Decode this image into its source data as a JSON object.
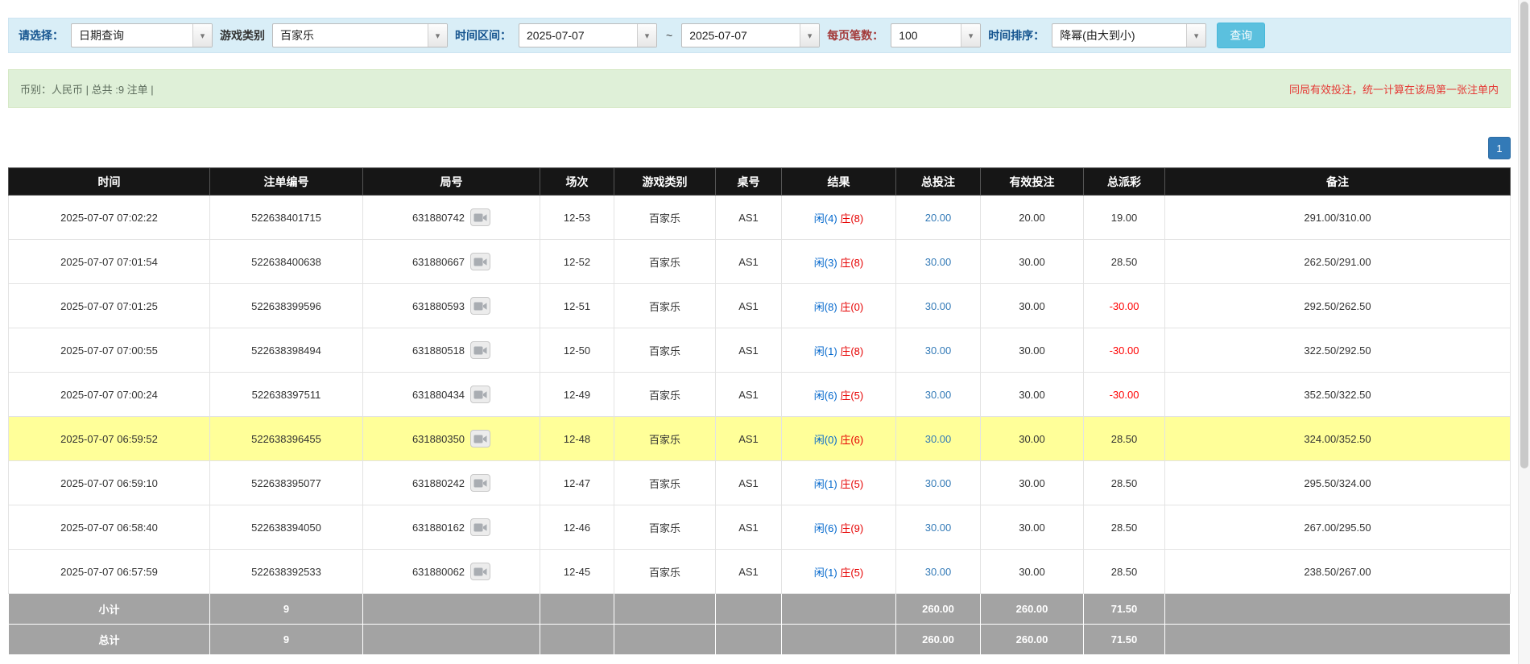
{
  "icons": {
    "chevron_down": "▾"
  },
  "filters": {
    "select_label": "请选择：",
    "select_value": "日期查询",
    "game_type_label": "游戏类别",
    "game_type_value": "百家乐",
    "time_range_label": "时间区间：",
    "date_from": "2025-07-07",
    "range_separator": "~",
    "date_to": "2025-07-07",
    "page_size_label": "每页笔数：",
    "page_size_value": "100",
    "sort_label": "时间排序：",
    "sort_value": "降幂(由大到小)",
    "search_button": "查询"
  },
  "summary": {
    "left": "币别：人民币 | 总共 :9 注单 |",
    "right": "同局有效投注，统一计算在该局第一张注单内"
  },
  "pagination": {
    "current_page": "1"
  },
  "table": {
    "headers": [
      "时间",
      "注单编号",
      "局号",
      "场次",
      "游戏类别",
      "桌号",
      "结果",
      "总投注",
      "有效投注",
      "总派彩",
      "备注"
    ],
    "rows": [
      {
        "time": "2025-07-07 07:02:22",
        "bet_id": "522638401715",
        "round_id": "631880742",
        "session": "12-53",
        "game": "百家乐",
        "table_no": "AS1",
        "result_player": "闲(4)",
        "result_banker": "庄(8)",
        "total_bet": "20.00",
        "valid_bet": "20.00",
        "payout": "19.00",
        "note": "291.00/310.00",
        "highlight": false
      },
      {
        "time": "2025-07-07 07:01:54",
        "bet_id": "522638400638",
        "round_id": "631880667",
        "session": "12-52",
        "game": "百家乐",
        "table_no": "AS1",
        "result_player": "闲(3)",
        "result_banker": "庄(8)",
        "total_bet": "30.00",
        "valid_bet": "30.00",
        "payout": "28.50",
        "note": "262.50/291.00",
        "highlight": false
      },
      {
        "time": "2025-07-07 07:01:25",
        "bet_id": "522638399596",
        "round_id": "631880593",
        "session": "12-51",
        "game": "百家乐",
        "table_no": "AS1",
        "result_player": "闲(8)",
        "result_banker": "庄(0)",
        "total_bet": "30.00",
        "valid_bet": "30.00",
        "payout": "-30.00",
        "note": "292.50/262.50",
        "highlight": false
      },
      {
        "time": "2025-07-07 07:00:55",
        "bet_id": "522638398494",
        "round_id": "631880518",
        "session": "12-50",
        "game": "百家乐",
        "table_no": "AS1",
        "result_player": "闲(1)",
        "result_banker": "庄(8)",
        "total_bet": "30.00",
        "valid_bet": "30.00",
        "payout": "-30.00",
        "note": "322.50/292.50",
        "highlight": false
      },
      {
        "time": "2025-07-07 07:00:24",
        "bet_id": "522638397511",
        "round_id": "631880434",
        "session": "12-49",
        "game": "百家乐",
        "table_no": "AS1",
        "result_player": "闲(6)",
        "result_banker": "庄(5)",
        "total_bet": "30.00",
        "valid_bet": "30.00",
        "payout": "-30.00",
        "note": "352.50/322.50",
        "highlight": false
      },
      {
        "time": "2025-07-07 06:59:52",
        "bet_id": "522638396455",
        "round_id": "631880350",
        "session": "12-48",
        "game": "百家乐",
        "table_no": "AS1",
        "result_player": "闲(0)",
        "result_banker": "庄(6)",
        "total_bet": "30.00",
        "valid_bet": "30.00",
        "payout": "28.50",
        "note": "324.00/352.50",
        "highlight": true
      },
      {
        "time": "2025-07-07 06:59:10",
        "bet_id": "522638395077",
        "round_id": "631880242",
        "session": "12-47",
        "game": "百家乐",
        "table_no": "AS1",
        "result_player": "闲(1)",
        "result_banker": "庄(5)",
        "total_bet": "30.00",
        "valid_bet": "30.00",
        "payout": "28.50",
        "note": "295.50/324.00",
        "highlight": false
      },
      {
        "time": "2025-07-07 06:58:40",
        "bet_id": "522638394050",
        "round_id": "631880162",
        "session": "12-46",
        "game": "百家乐",
        "table_no": "AS1",
        "result_player": "闲(6)",
        "result_banker": "庄(9)",
        "total_bet": "30.00",
        "valid_bet": "30.00",
        "payout": "28.50",
        "note": "267.00/295.50",
        "highlight": false
      },
      {
        "time": "2025-07-07 06:57:59",
        "bet_id": "522638392533",
        "round_id": "631880062",
        "session": "12-45",
        "game": "百家乐",
        "table_no": "AS1",
        "result_player": "闲(1)",
        "result_banker": "庄(5)",
        "total_bet": "30.00",
        "valid_bet": "30.00",
        "payout": "28.50",
        "note": "238.50/267.00",
        "highlight": false
      }
    ],
    "footer": [
      {
        "label": "小计",
        "count": "9",
        "total_bet": "260.00",
        "valid_bet": "260.00",
        "payout": "71.50"
      },
      {
        "label": "总计",
        "count": "9",
        "total_bet": "260.00",
        "valid_bet": "260.00",
        "payout": "71.50"
      }
    ]
  }
}
